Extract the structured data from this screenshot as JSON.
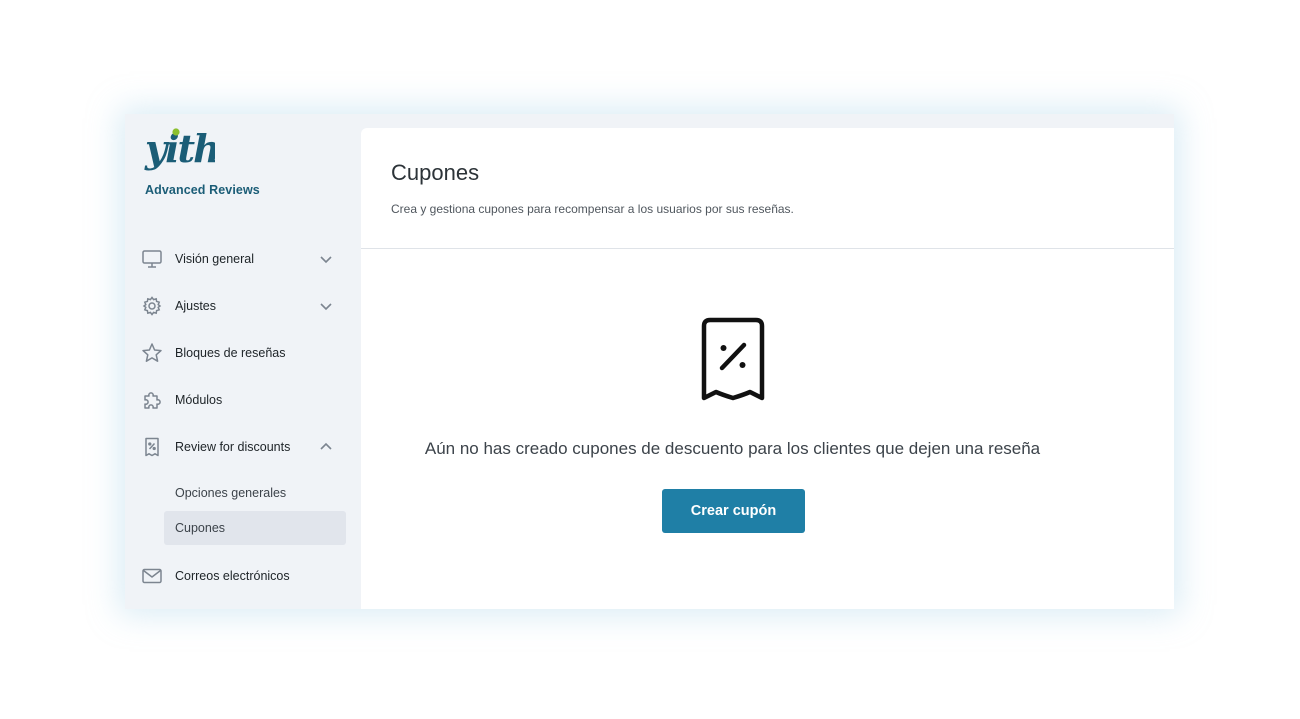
{
  "brand": {
    "logo_text": "yith",
    "plugin_name": "Advanced Reviews",
    "logo_color": "#1b5d77",
    "logo_dot_color": "#8bbf2f"
  },
  "sidebar": {
    "items": [
      {
        "label": "Visión general",
        "icon": "monitor-icon",
        "chevron": "chevron-down-icon"
      },
      {
        "label": "Ajustes",
        "icon": "gear-icon",
        "chevron": "chevron-down-icon"
      },
      {
        "label": "Bloques de reseñas",
        "icon": "star-icon"
      },
      {
        "label": "Módulos",
        "icon": "puzzle-icon"
      },
      {
        "label": "Review for discounts",
        "icon": "coupon-icon",
        "chevron": "chevron-up-icon",
        "expanded": true,
        "submenu": [
          {
            "label": "Opciones generales",
            "active": false
          },
          {
            "label": "Cupones",
            "active": true
          }
        ]
      },
      {
        "label": "Correos electrónicos",
        "icon": "mail-icon"
      }
    ]
  },
  "main": {
    "title": "Cupones",
    "description": "Crea y gestiona cupones para recompensar a los usuarios por sus reseñas.",
    "empty_state": {
      "icon": "coupon-icon",
      "message": "Aún no has creado cupones de descuento para los clientes que dejen una reseña",
      "button_label": "Crear cupón"
    }
  },
  "colors": {
    "accent": "#1f7fa6",
    "sidebar_bg": "#f0f3f7",
    "active_item_bg": "#e1e5ec"
  }
}
